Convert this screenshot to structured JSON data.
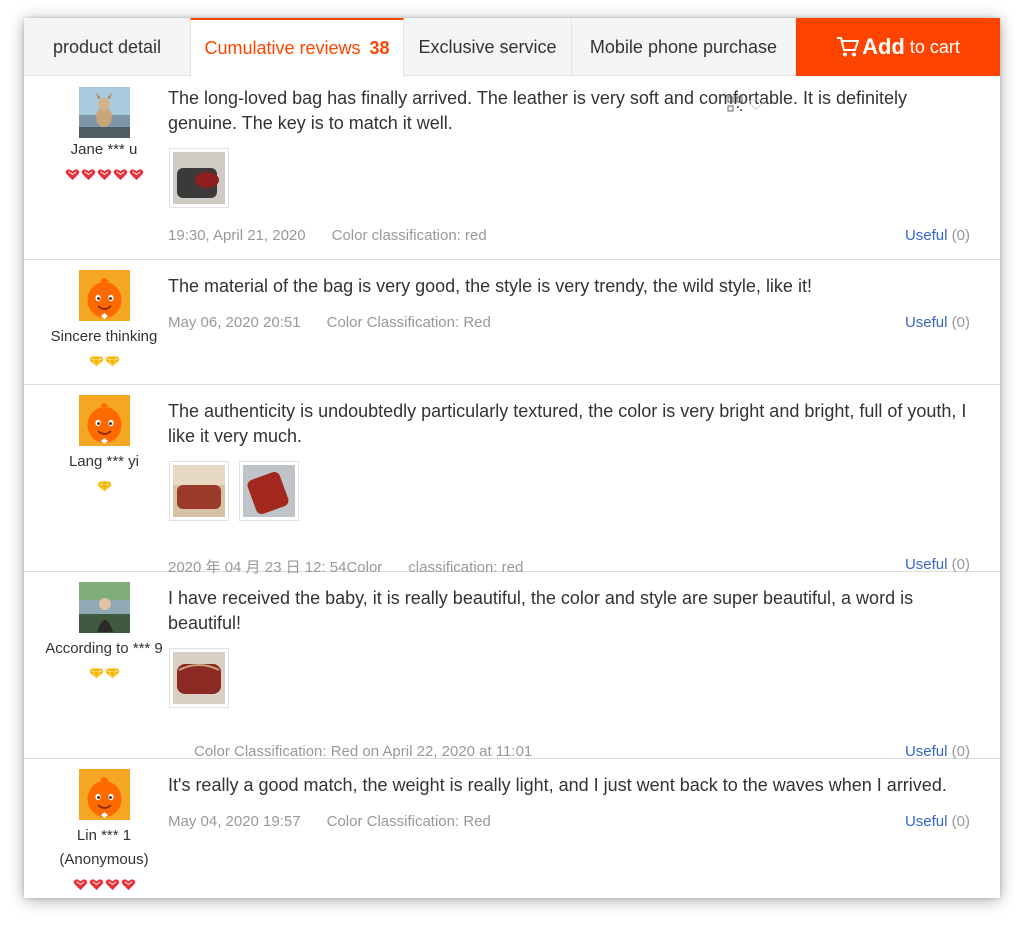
{
  "tabs": {
    "product_detail": "product detail",
    "reviews_label": "Cumulative reviews",
    "reviews_count": "38",
    "exclusive": "Exclusive service",
    "mobile": "Mobile phone purchase"
  },
  "cart": {
    "add": "Add",
    "to_cart": "to cart"
  },
  "useful_label": "Useful",
  "reviews": [
    {
      "user": "Jane *** u",
      "rank_icon": "red-heart-badge-icon",
      "rank_count": 5,
      "text": "The long-loved bag has finally arrived. The leather is very soft and comfortable. It is definitely genuine. The key is to match it well.",
      "date": "19:30, April 21, 2020",
      "color": "Color classification: red",
      "useful_count": "(0)"
    },
    {
      "user": "Sincere thinking",
      "rank_icon": "gold-diamond-icon",
      "rank_count": 2,
      "text": "The material of the bag is very good, the style is very trendy, the wild style, like it!",
      "date": "May 06, 2020 20:51",
      "color": "Color Classification: Red",
      "useful_count": "(0)"
    },
    {
      "user": "Lang *** yi",
      "rank_icon": "gold-diamond-icon",
      "rank_count": 1,
      "text": "The authenticity is undoubtedly particularly textured, the color is very bright and bright, full of youth, I like it very much.",
      "date": "2020 年 04 月 23 日 12: 54Color",
      "color": "classification: red",
      "useful_count": "(0)"
    },
    {
      "user": "According to *** 9",
      "rank_icon": "gold-diamond-icon",
      "rank_count": 2,
      "text": "I have received the baby, it is really beautiful, the color and style are super beautiful, a word is beautiful!",
      "date": "",
      "color": "Color Classification: Red on April 22, 2020 at 11:01",
      "useful_count": "(0)"
    },
    {
      "user": "Lin *** 1",
      "user_sub": "(Anonymous)",
      "rank_icon": "red-heart-badge-icon",
      "rank_count": 4,
      "text": "It's really a good match, the weight is really light, and I just went back to the waves when I arrived.",
      "date": "May 04, 2020 19:57",
      "color": "Color Classification: Red",
      "useful_count": "(0)"
    }
  ],
  "colors": {
    "accent": "#ff4400",
    "link": "#3366cc",
    "meta": "#999999"
  }
}
